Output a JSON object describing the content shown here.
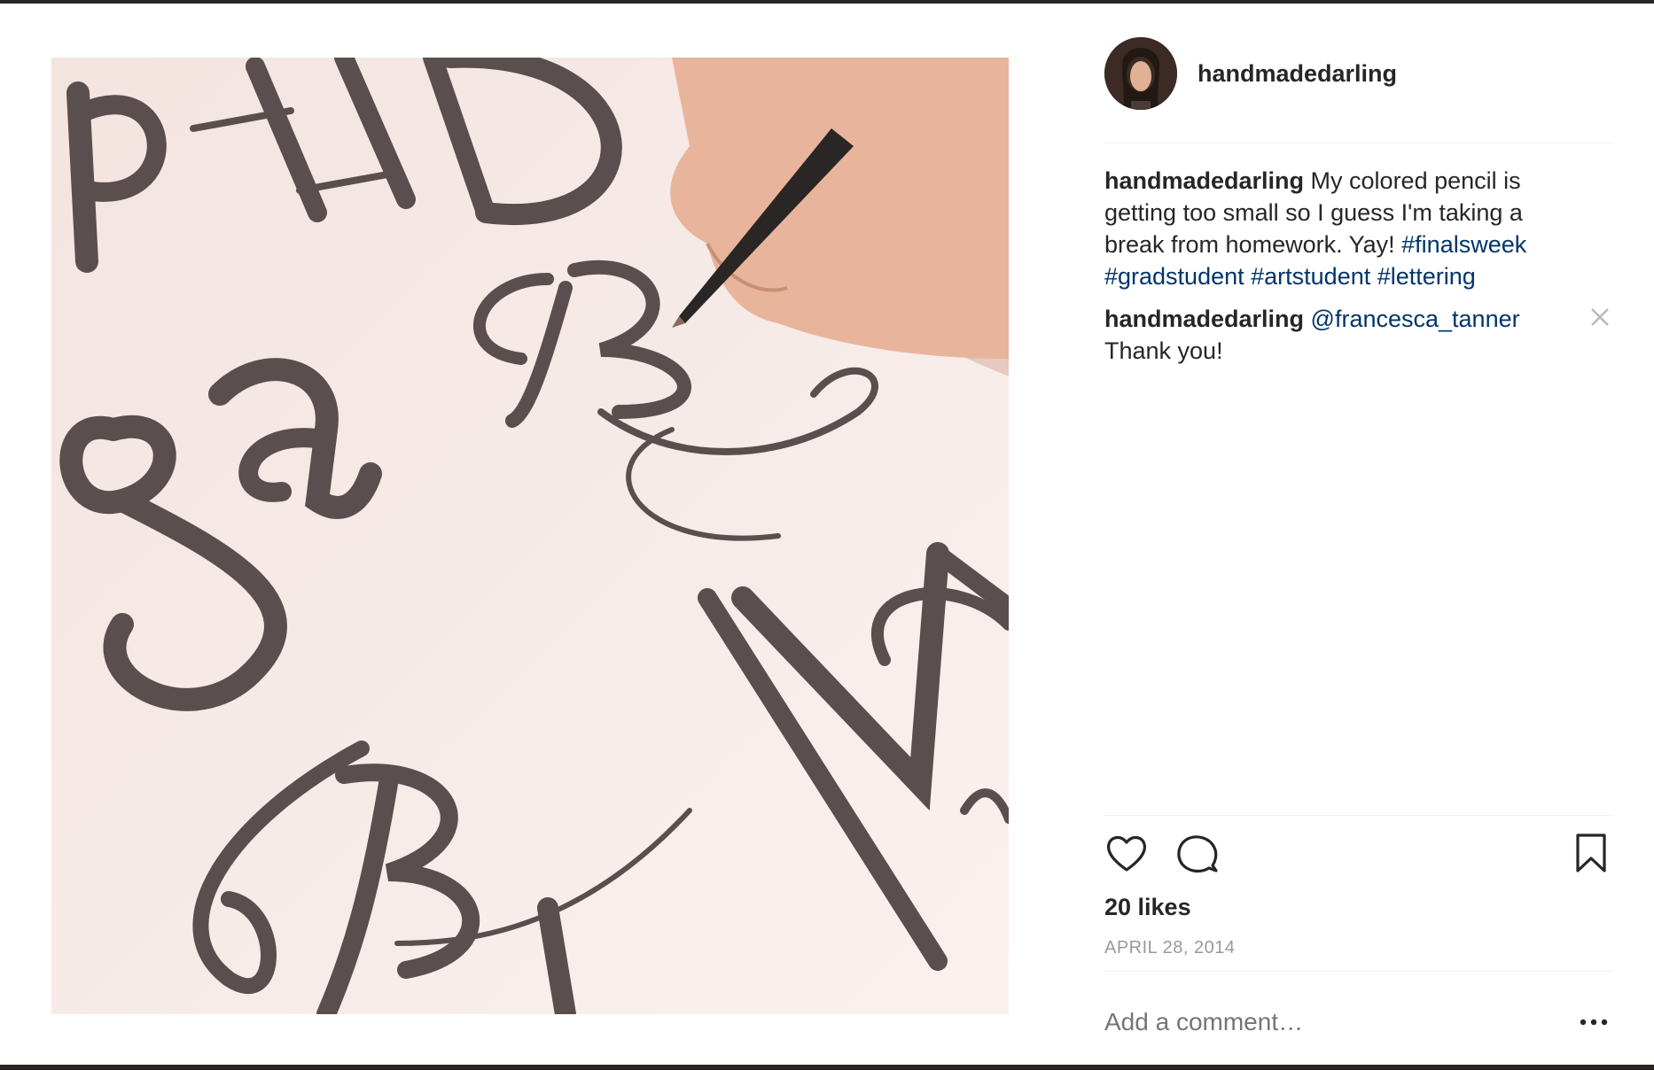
{
  "post": {
    "username": "handmadedarling",
    "caption": {
      "username": "handmadedarling",
      "text": "My colored pencil is getting too small so I guess I'm taking a break from homework. Yay!",
      "hashtags": [
        "#finalsweek",
        "#gradstudent",
        "#artstudent",
        "#lettering"
      ]
    },
    "comment": {
      "username": "handmadedarling",
      "mention": "@francesca_tanner",
      "text": "Thank you!"
    },
    "likes": "20 likes",
    "date": "APRIL 28, 2014",
    "add_comment_placeholder": "Add a comment…"
  },
  "icons": {
    "like": "heart-icon",
    "comment": "comment-icon",
    "save": "bookmark-icon",
    "close": "close-icon",
    "more": "more-options-icon"
  },
  "colors": {
    "hashtag": "#003569",
    "text": "#262626",
    "muted": "#999999"
  }
}
